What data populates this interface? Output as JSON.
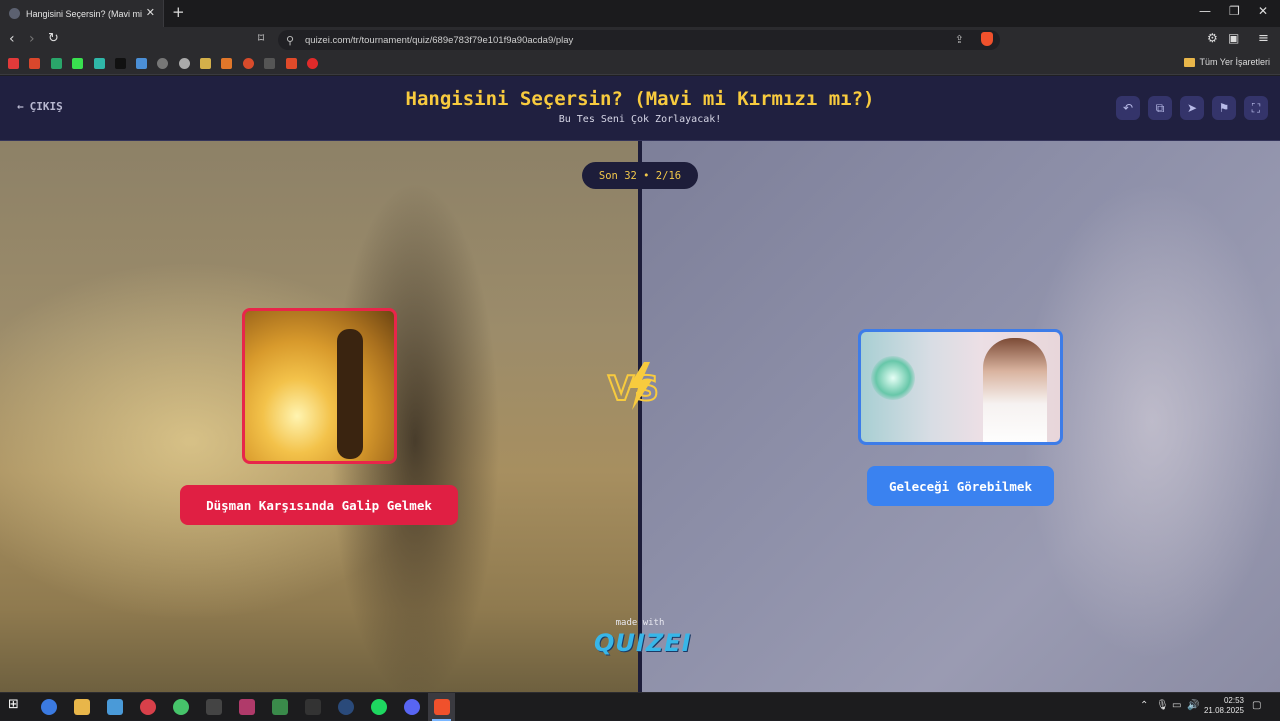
{
  "browser": {
    "tab_title": "Hangisini Seçersin? (Mavi mi Kırmı",
    "url": "quizei.com/tr/tournament/quiz/689e783f79e101f9a90acda9/play",
    "bookmarks_folder": "Tüm Yer İşaretleri",
    "bookmark_icons": [
      "youtube-icon",
      "gmail-icon",
      "cg-icon",
      "kick-icon",
      "bookmark-icon",
      "terminal-icon",
      "grid-icon",
      "at-icon",
      "target-icon",
      "app-icon",
      "hb-icon",
      "shop-icon",
      "w-icon",
      "web-icon",
      "youtube-icon-2"
    ]
  },
  "quiz": {
    "exit_label": "ÇIKIŞ",
    "title": "Hangisini Seçersin? (Mavi mi Kırmızı mı?)",
    "subtitle": "Bu Tes Seni Çok Zorlayacak!",
    "round": "Son 32 • 2/16",
    "left_option": "Düşman Karşısında Galip Gelmek",
    "right_option": "Geleceği Görebilmek",
    "made_with": "made with",
    "brand": "QUIZEI"
  },
  "taskbar": {
    "time": "02:53",
    "date": "21.08.2025"
  },
  "colors": {
    "red": "#e01f43",
    "blue": "#3a82f0",
    "gold": "#f8cb3e",
    "header": "#202040"
  }
}
